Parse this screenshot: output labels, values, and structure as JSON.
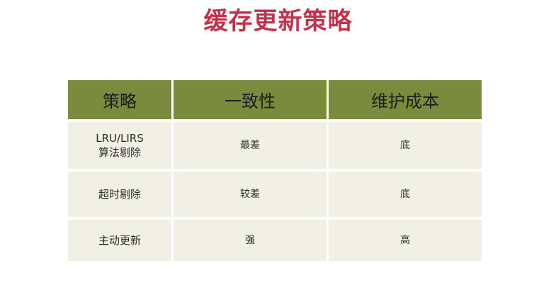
{
  "title": "缓存更新策略",
  "table": {
    "headers": [
      "策略",
      "一致性",
      "维护成本"
    ],
    "rows": [
      {
        "strategy": [
          "LRU/LIRS",
          "算法剔除"
        ],
        "consistency": "最差",
        "cost": "底"
      },
      {
        "strategy": [
          "超时剔除"
        ],
        "consistency": "较差",
        "cost": "底"
      },
      {
        "strategy": [
          "主动更新"
        ],
        "consistency": "强",
        "cost": "高"
      }
    ]
  }
}
